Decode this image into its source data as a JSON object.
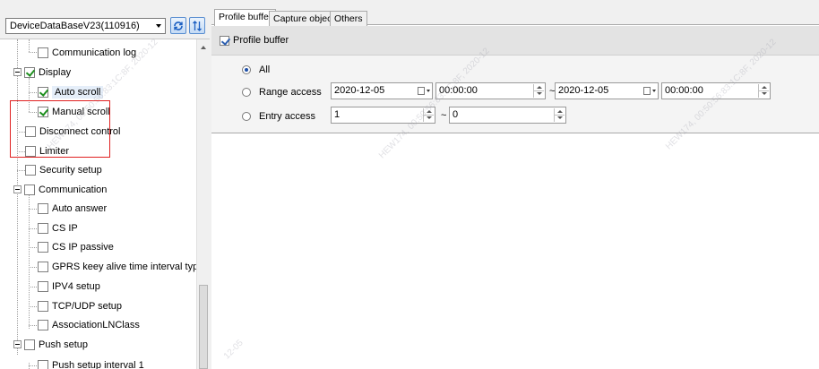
{
  "database": {
    "selected": "DeviceDataBaseV23(110916)"
  },
  "tree": {
    "items": [
      {
        "label": "Communication log",
        "checked": false
      },
      {
        "label": "Display",
        "checked": true
      },
      {
        "label": "Auto scroll",
        "checked": true
      },
      {
        "label": "Manual scroll",
        "checked": true
      },
      {
        "label": "Disconnect control",
        "checked": false
      },
      {
        "label": "Limiter",
        "checked": false
      },
      {
        "label": "Security setup",
        "checked": false
      },
      {
        "label": "Communication",
        "checked": false
      },
      {
        "label": "Auto answer",
        "checked": false
      },
      {
        "label": "CS IP",
        "checked": false
      },
      {
        "label": "CS IP passive",
        "checked": false
      },
      {
        "label": "GPRS keey alive time interval type",
        "checked": false
      },
      {
        "label": "IPV4 setup",
        "checked": false
      },
      {
        "label": "TCP/UDP setup",
        "checked": false
      },
      {
        "label": "AssociationLNClass",
        "checked": false
      },
      {
        "label": "Push setup",
        "checked": false
      },
      {
        "label": "Push setup interval 1",
        "checked": false
      }
    ]
  },
  "tabs": [
    {
      "label": "Profile buffer",
      "active": true
    },
    {
      "label": "Capture object",
      "active": false
    },
    {
      "label": "Others",
      "active": false
    }
  ],
  "profile_buffer": {
    "header_label": "Profile buffer",
    "header_checked": true,
    "options": [
      {
        "label": "All",
        "selected": true
      },
      {
        "label": "Range access",
        "selected": false
      },
      {
        "label": "Entry access",
        "selected": false
      }
    ],
    "range": {
      "start_date": "2020-12-05",
      "start_time": "00:00:00",
      "separator": "~",
      "end_date": "2020-12-05",
      "end_time": "00:00:00"
    },
    "entry": {
      "from": "1",
      "separator": "~",
      "to": "0"
    }
  },
  "watermark": {
    "lines": [
      "HEW174, 00:50:56:83:1C:8F, 2020-12",
      "HEW174, 00:50:56:83:1C:8F, 2020-12",
      "HEW174, 00:50:56:83:1C:8F, 2020-12",
      "12-05"
    ]
  },
  "colors": {
    "highlight_box": "#e02020",
    "checkbox_check": "#1e8f1e",
    "radio_dot": "#1d4fa8"
  }
}
